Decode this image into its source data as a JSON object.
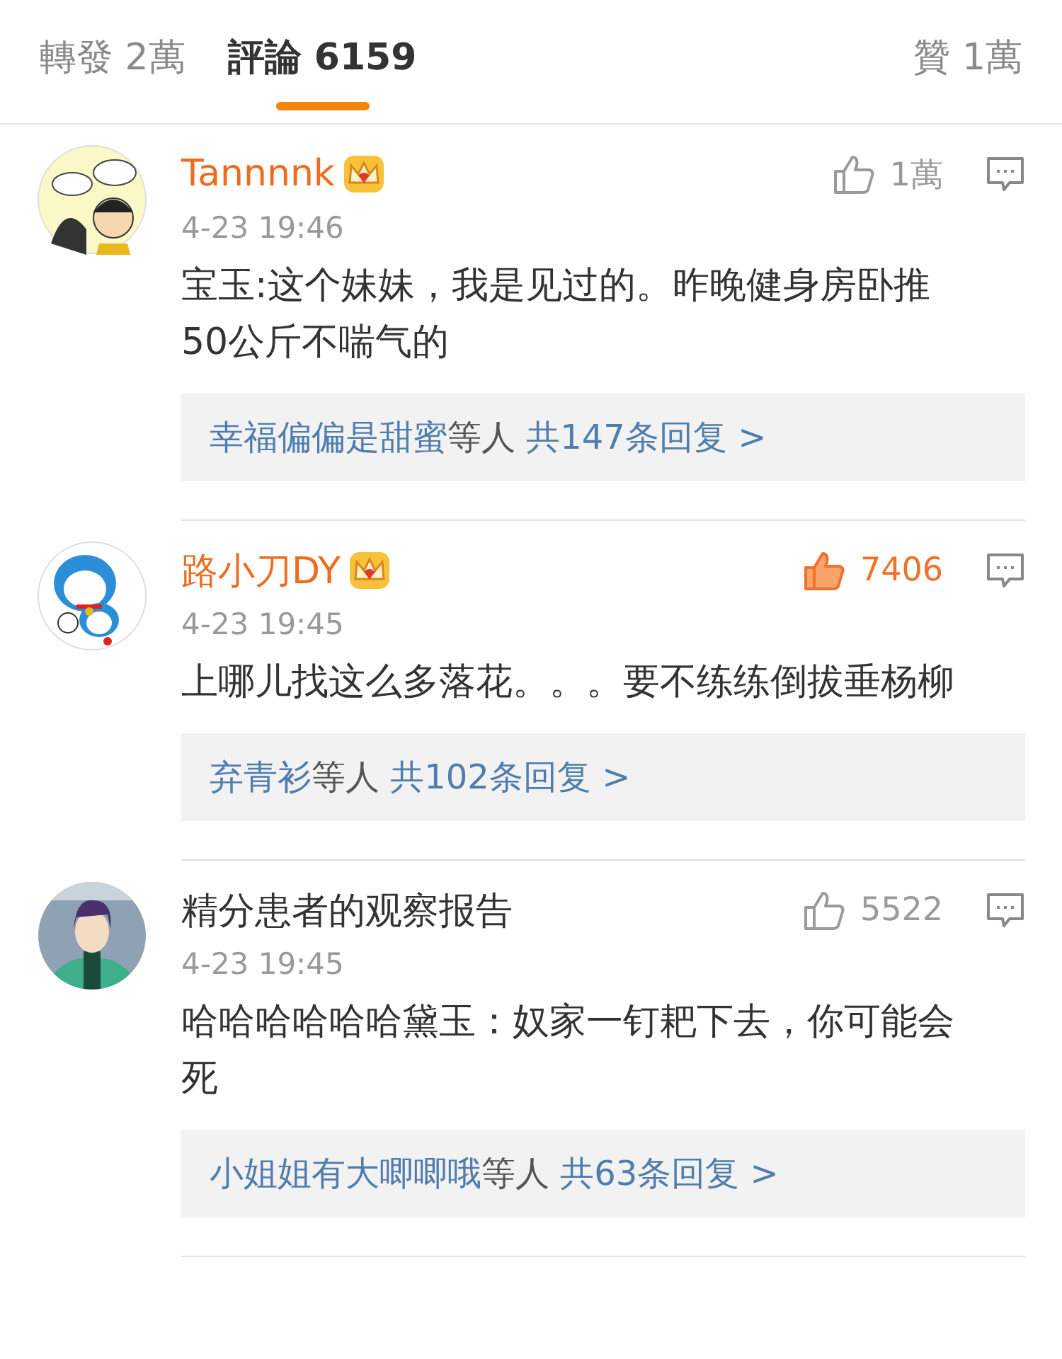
{
  "tabs": [
    {
      "label": "轉發",
      "count": "2萬",
      "selected": false
    },
    {
      "label": "評論",
      "count": "6159",
      "selected": true
    }
  ],
  "like_tab": {
    "label": "贊",
    "count": "1萬"
  },
  "comments": [
    {
      "user": "Tannnnk",
      "vip": true,
      "time": "4-23 19:46",
      "likes": "1萬",
      "liked": false,
      "text": "宝玉:这个妹妹，我是见过的。昨晚健身房卧推50公斤不喘气的",
      "reply_names": "幸福偏偏是甜蜜",
      "reply_suffix": "等人",
      "reply_count": "共147条回复 >"
    },
    {
      "user": "路小刀DY",
      "vip": true,
      "time": "4-23 19:45",
      "likes": "7406",
      "liked": true,
      "text": "上哪儿找这么多落花。。。要不练练倒拔垂杨柳",
      "reply_names": "弃青衫",
      "reply_suffix": "等人",
      "reply_count": "共102条回复 >"
    },
    {
      "user": "精分患者的观察报告",
      "vip": false,
      "time": "4-23 19:45",
      "likes": "5522",
      "liked": false,
      "text": "哈哈哈哈哈哈黛玉：奴家一钉耙下去，你可能会死",
      "reply_names": "小姐姐有大唧唧哦",
      "reply_suffix": "等人",
      "reply_count": "共63条回复 >"
    }
  ]
}
